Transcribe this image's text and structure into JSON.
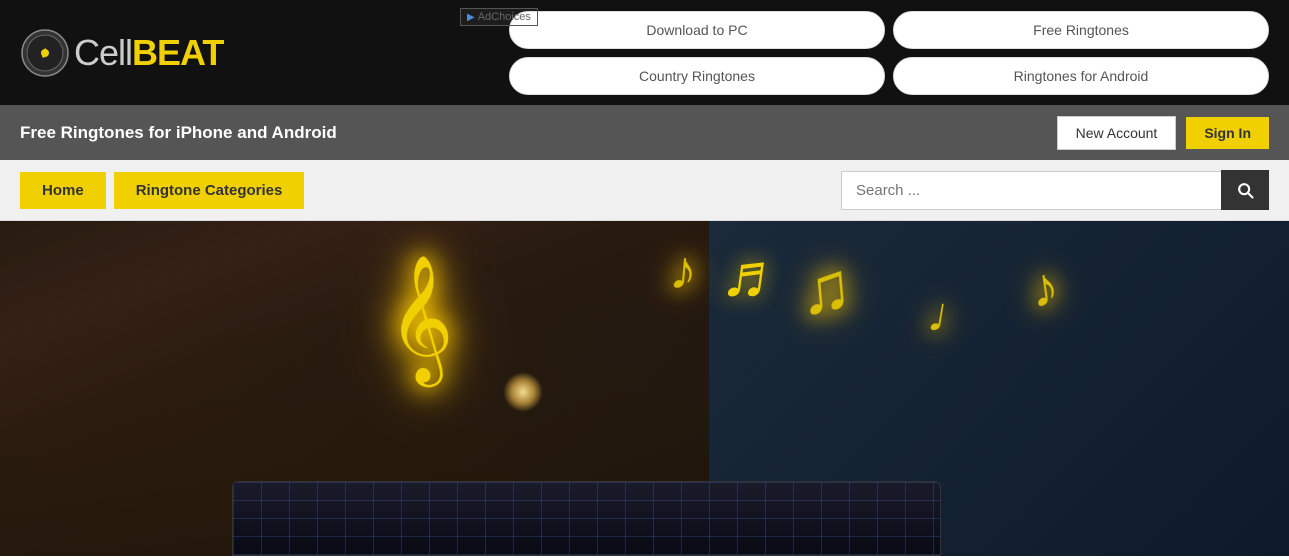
{
  "brand": {
    "name_cell": "Cell",
    "name_beat": "BEAT",
    "full_name": "CellBEAT"
  },
  "ad": {
    "label": "AdChoices"
  },
  "nav_buttons": [
    {
      "id": "download-pc",
      "label": "Download to PC"
    },
    {
      "id": "country-ringtones",
      "label": "Country Ringtones"
    },
    {
      "id": "free-ringtones",
      "label": "Free Ringtones"
    },
    {
      "id": "ringtones-android",
      "label": "Ringtones for Android"
    }
  ],
  "account_bar": {
    "tagline": "Free Ringtones for iPhone and Android",
    "new_account_label": "New Account",
    "sign_in_label": "Sign In"
  },
  "nav_bar": {
    "home_label": "Home",
    "categories_label": "Ringtone Categories",
    "search_placeholder": "Search ..."
  },
  "hero": {
    "music_notes": [
      "♪",
      "♫",
      "♩",
      "♬",
      "♪"
    ],
    "treble_clef": "𝄞"
  },
  "colors": {
    "yellow": "#f0d000",
    "dark": "#111111",
    "gray": "#555555",
    "search_bg": "#333333"
  }
}
